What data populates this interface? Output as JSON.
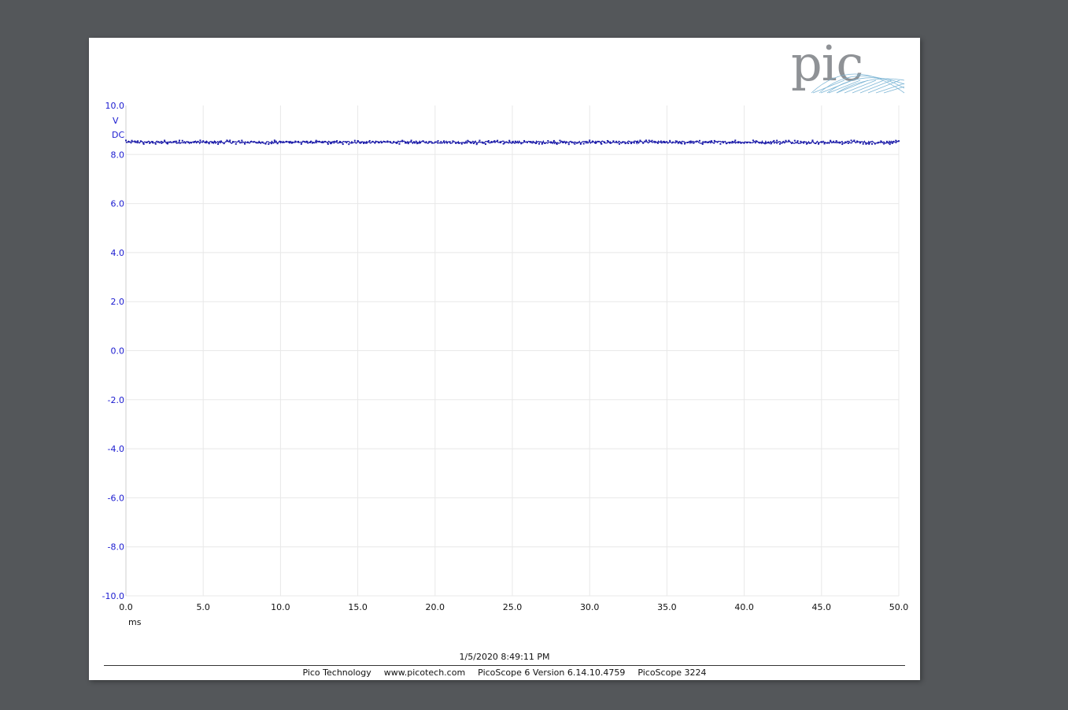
{
  "logo": {
    "text": "pic"
  },
  "chart_data": {
    "type": "line",
    "x_unit": "ms",
    "y_unit": "V",
    "y_coupling": "DC",
    "xlim": [
      0.0,
      50.0
    ],
    "ylim": [
      -10.0,
      10.0
    ],
    "x_ticks": [
      "0.0",
      "5.0",
      "10.0",
      "15.0",
      "20.0",
      "25.0",
      "30.0",
      "35.0",
      "40.0",
      "45.0",
      "50.0"
    ],
    "y_ticks": [
      "10.0",
      "8.0",
      "6.0",
      "4.0",
      "2.0",
      "0.0",
      "-2.0",
      "-4.0",
      "-6.0",
      "-8.0",
      "-10.0"
    ],
    "grid": true,
    "series": [
      {
        "color": "#1a1aa8",
        "x": [
          0,
          5,
          10,
          15,
          20,
          25,
          30,
          35,
          40,
          45,
          50
        ],
        "values": [
          8.5,
          8.5,
          8.5,
          8.5,
          8.5,
          8.5,
          8.5,
          8.5,
          8.5,
          8.5,
          8.5
        ],
        "noise_amplitude": 0.05
      }
    ]
  },
  "timestamp": "1/5/2020 8:49:11 PM",
  "footer": {
    "company": "Pico Technology",
    "website": "www.picotech.com",
    "software": "PicoScope 6 Version 6.14.10.4759",
    "device": "PicoScope 3224"
  },
  "colors": {
    "page_bg": "#54575a",
    "sheet_bg": "#ffffff",
    "axis_blue": "#1a1ad0",
    "grid": "#e6e6e6",
    "logo_grey": "#8f9296"
  }
}
